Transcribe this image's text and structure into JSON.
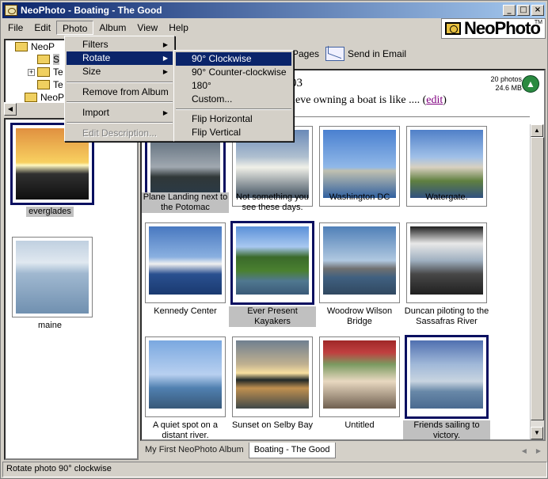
{
  "window": {
    "title": "NeoPhoto - Boating - The Good"
  },
  "menubar": [
    "File",
    "Edit",
    "Photo",
    "Album",
    "View",
    "Help"
  ],
  "logo": {
    "text": "NeoPhoto",
    "tm": "TM"
  },
  "toolbar": {
    "pages_label": "Pages",
    "email_label": "Send in Email"
  },
  "tree": {
    "items": [
      "NeoP",
      "S",
      "Te",
      "Te",
      "NeoP"
    ]
  },
  "header": {
    "date_fragment": "03",
    "description": "elieve owning a boat is like ....",
    "edit_link": "edit",
    "photo_count": "20 photos",
    "size": "24.6 MB"
  },
  "photo_menu": {
    "items": [
      "Filters",
      "Rotate",
      "Size",
      "Remove from Album",
      "Import",
      "Edit Description..."
    ]
  },
  "rotate_menu": {
    "items": [
      "90° Clockwise",
      "90° Counter-clockwise",
      "180°",
      "Custom...",
      "Flip Horizontal",
      "Flip Vertical"
    ]
  },
  "albums": [
    {
      "name": "everglades",
      "selected": true
    },
    {
      "name": "maine",
      "selected": false
    }
  ],
  "photos": [
    {
      "caption": "Plane Landing next to the Potomac",
      "selected": true
    },
    {
      "caption": "Not something you see these days.",
      "selected": false
    },
    {
      "caption": "Washington DC",
      "selected": false
    },
    {
      "caption": "Watergate.",
      "selected": false
    },
    {
      "caption": "Kennedy Center",
      "selected": false
    },
    {
      "caption": "Ever Present Kayakers",
      "selected": true
    },
    {
      "caption": "Woodrow Wilson Bridge",
      "selected": false
    },
    {
      "caption": "Duncan piloting to the Sassafras River",
      "selected": false
    },
    {
      "caption": "A quiet spot on a distant river.",
      "selected": false
    },
    {
      "caption": "Sunset on Selby Bay",
      "selected": false
    },
    {
      "caption": "Untitled",
      "selected": false
    },
    {
      "caption": "Friends sailing to victory.",
      "selected": true
    }
  ],
  "tabs": [
    "My First NeoPhoto Album",
    "Boating - The Good"
  ],
  "status": "Rotate photo 90° clockwise"
}
